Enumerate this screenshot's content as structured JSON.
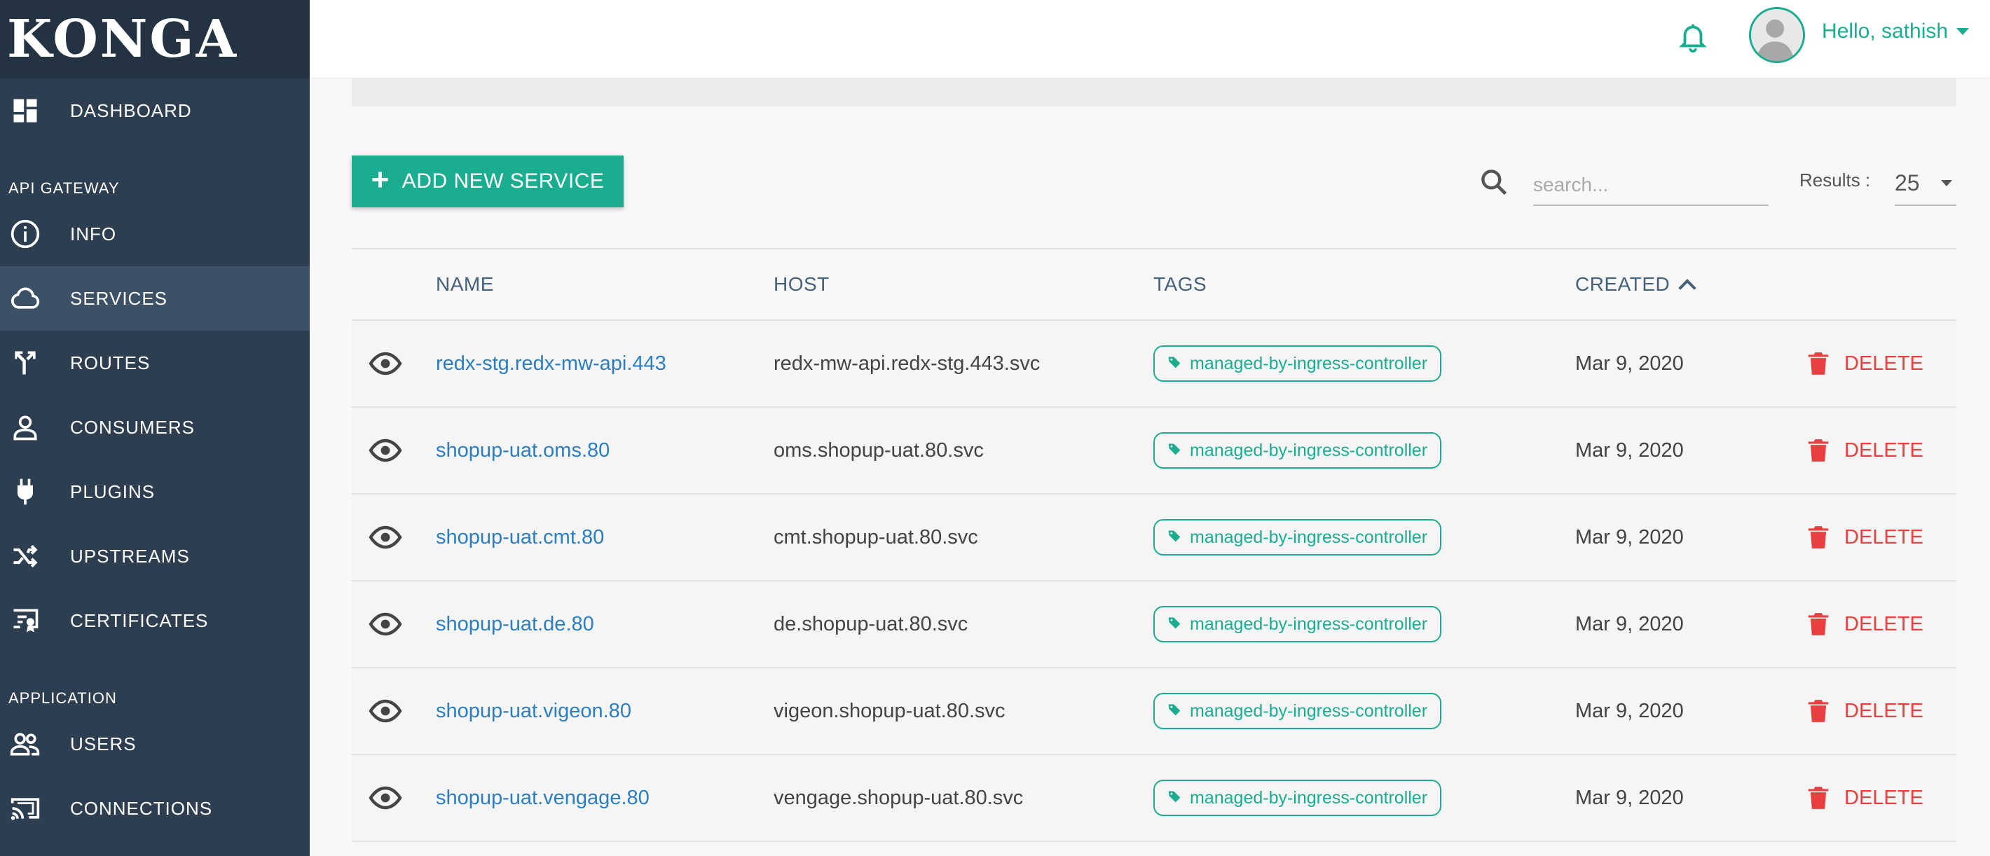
{
  "app": {
    "logo": "KONGA"
  },
  "sidebar": {
    "dashboard": {
      "label": "DASHBOARD",
      "icon": "dashboard-icon"
    },
    "sections": [
      {
        "title": "API GATEWAY"
      },
      {
        "title": "APPLICATION"
      }
    ],
    "items": [
      {
        "label": "INFO",
        "icon": "info-icon"
      },
      {
        "label": "SERVICES",
        "icon": "cloud-icon",
        "active": true
      },
      {
        "label": "ROUTES",
        "icon": "routes-icon"
      },
      {
        "label": "CONSUMERS",
        "icon": "user-icon"
      },
      {
        "label": "PLUGINS",
        "icon": "plug-icon"
      },
      {
        "label": "UPSTREAMS",
        "icon": "shuffle-icon"
      },
      {
        "label": "CERTIFICATES",
        "icon": "certificate-icon"
      },
      {
        "label": "USERS",
        "icon": "users-icon"
      },
      {
        "label": "CONNECTIONS",
        "icon": "cast-icon"
      }
    ]
  },
  "header": {
    "greeting": "Hello, sathish",
    "accent": "#1aad90"
  },
  "toolbar": {
    "add_label": "ADD NEW SERVICE",
    "search_placeholder": "search...",
    "results_label": "Results :",
    "results_value": "25"
  },
  "table": {
    "columns": {
      "name": "NAME",
      "host": "HOST",
      "tags": "TAGS",
      "created": "CREATED"
    },
    "delete_label": "DELETE",
    "rows": [
      {
        "name": "redx-stg.redx-mw-api.443",
        "host": "redx-mw-api.redx-stg.443.svc",
        "tag": "managed-by-ingress-controller",
        "created": "Mar 9, 2020"
      },
      {
        "name": "shopup-uat.oms.80",
        "host": "oms.shopup-uat.80.svc",
        "tag": "managed-by-ingress-controller",
        "created": "Mar 9, 2020"
      },
      {
        "name": "shopup-uat.cmt.80",
        "host": "cmt.shopup-uat.80.svc",
        "tag": "managed-by-ingress-controller",
        "created": "Mar 9, 2020"
      },
      {
        "name": "shopup-uat.de.80",
        "host": "de.shopup-uat.80.svc",
        "tag": "managed-by-ingress-controller",
        "created": "Mar 9, 2020"
      },
      {
        "name": "shopup-uat.vigeon.80",
        "host": "vigeon.shopup-uat.80.svc",
        "tag": "managed-by-ingress-controller",
        "created": "Mar 9, 2020"
      },
      {
        "name": "shopup-uat.vengage.80",
        "host": "vengage.shopup-uat.80.svc",
        "tag": "managed-by-ingress-controller",
        "created": "Mar 9, 2020"
      }
    ]
  }
}
